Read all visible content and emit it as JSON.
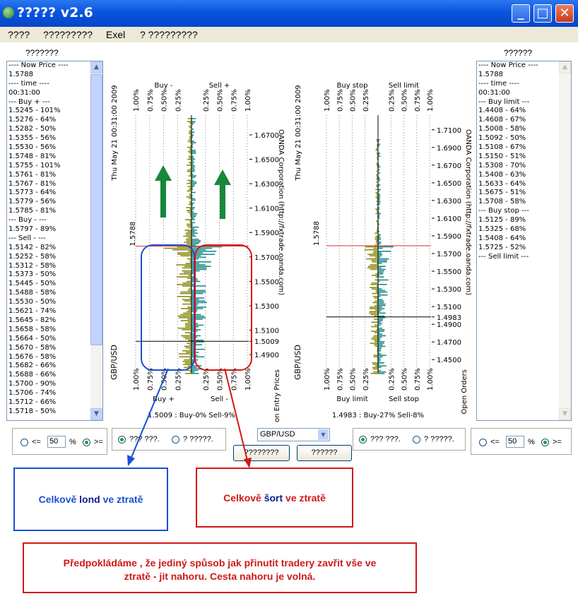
{
  "window": {
    "title": "????? v2.6",
    "minimize": "_",
    "maximize": "□",
    "close": "✕"
  },
  "menu": [
    {
      "label": "????"
    },
    {
      "label": "?????????"
    },
    {
      "label": "Exel"
    },
    {
      "label": "? ?????????"
    }
  ],
  "left_panel": {
    "title": "???????",
    "rows": [
      "---- Now Price ----",
      "1.5788",
      "---- time ----",
      "00:31:00",
      "--- Buy + ---",
      "1.5245 - 101%",
      "1.5276 - 64%",
      "1.5282 - 50%",
      "1.5355 - 56%",
      "1.5530 - 56%",
      "1.5748 - 81%",
      "1.5755 - 101%",
      "1.5761 - 81%",
      "1.5767 - 81%",
      "1.5773 - 64%",
      "1.5779 - 56%",
      "1.5785 - 81%",
      "--- Buy - ---",
      "1.5797 - 89%",
      "--- Sell - ---",
      "1.5142 - 82%",
      "1.5252 - 58%",
      "1.5312 - 58%",
      "1.5373 - 50%",
      "1.5445 - 50%",
      "1.5488 - 58%",
      "1.5530 - 50%",
      "1.5621 - 74%",
      "1.5645 - 82%",
      "1.5658 - 58%",
      "1.5664 - 50%",
      "1.5670 - 58%",
      "1.5676 - 58%",
      "1.5682 - 66%",
      "1.5688 - 66%",
      "1.5700 - 90%",
      "1.5706 - 74%",
      "1.5712 - 66%",
      "1.5718 - 50%"
    ]
  },
  "right_panel": {
    "title": "??????",
    "rows": [
      "---- Now Price ----",
      "1.5788",
      "---- time ----",
      "00:31:00",
      "--- Buy limit ---",
      "1.4408 - 64%",
      "1.4608 - 67%",
      "1.5008 - 58%",
      "1.5092 - 50%",
      "1.5108 - 67%",
      "1.5150 - 51%",
      "1.5308 - 70%",
      "1.5408 - 63%",
      "1.5633 - 64%",
      "1.5675 - 51%",
      "1.5708 - 58%",
      "--- Buy stop ---",
      "1.5125 - 89%",
      "1.5325 - 68%",
      "1.5408 - 64%",
      "1.5725 - 52%",
      "--- Sell limit ---"
    ]
  },
  "chart_data": [
    {
      "type": "bar",
      "title": "Open Position Entry Prices",
      "date_label": "Thu May 21 00:31:00 2009",
      "source": "OANDA Corporation (http://fxtrade.oanda.com)",
      "pair": "GBP/USD",
      "left_series": "Buy -",
      "right_series": "Sell +",
      "bottom_left_series": "Buy +",
      "bottom_right_series": "Sell -",
      "left_ticks": [
        "1.00%",
        "0.75%",
        "0.50%",
        "0.25%"
      ],
      "right_ticks": [
        "0.25%",
        "0.50%",
        "0.75%",
        "1.00%"
      ],
      "price_ticks": [
        "1.6700",
        "1.6500",
        "1.6300",
        "1.6100",
        "1.5900",
        "1.5700",
        "1.5500",
        "1.5300",
        "1.5100",
        "1.5009",
        "1.4900"
      ],
      "current_price": "1.5788",
      "ylim": [
        1.475,
        1.685
      ],
      "marker_price": 1.5009,
      "footer": "1.5009 : Buy-0% Sell-9%",
      "colors": {
        "buy": "#8c8c14",
        "sell": "#1f8b8b",
        "current": "#e03030",
        "marker": "#000000"
      }
    },
    {
      "type": "bar",
      "title": "Open Orders",
      "date_label": "Thu May 21 00:31:00 2009",
      "source": "OANDA Corporation (http://fxtrade.oanda.com)",
      "pair": "GBP/USD",
      "left_series": "Buy stop",
      "right_series": "Sell limit",
      "bottom_left_series": "Buy limit",
      "bottom_right_series": "Sell stop",
      "left_ticks": [
        "1.00%",
        "0.75%",
        "0.50%",
        "0.25%"
      ],
      "right_ticks": [
        "0.25%",
        "0.50%",
        "0.75%",
        "1.00%"
      ],
      "price_ticks": [
        "1.7100",
        "1.6900",
        "1.6700",
        "1.6500",
        "1.6300",
        "1.6100",
        "1.5900",
        "1.5700",
        "1.5500",
        "1.5300",
        "1.5100",
        "1.4983",
        "1.4900",
        "1.4700",
        "1.4500"
      ],
      "current_price": "1.5788",
      "ylim": [
        1.435,
        1.725
      ],
      "marker_price": 1.4983,
      "footer": "1.4983 : Buy-27%  Sell-8%",
      "colors": {
        "buy": "#8c8c14",
        "sell": "#1f8b8b",
        "current": "#e03030",
        "marker": "#000000"
      }
    }
  ],
  "controls": {
    "left": {
      "lte": "<=",
      "value": "50",
      "unit": "%",
      "gte": ">="
    },
    "mid_left": {
      "opt1": "??? ???.",
      "opt2": "? ?????."
    },
    "pair_select": "GBP/USD",
    "button1": "????????",
    "button2": "??????",
    "mid_right": {
      "opt1": "??? ???.",
      "opt2": "? ?????."
    },
    "right": {
      "lte": "<=",
      "value": "50",
      "unit": "%",
      "gte": ">="
    }
  },
  "annotations": {
    "long": {
      "prefix": "Celkově ",
      "highlight": "lond",
      "suffix": " ve ztratě",
      "color": "#1a4fd6"
    },
    "short": {
      "prefix": "Celkově ",
      "highlight": "šort",
      "suffix": " ve ztratě",
      "color": "#d01818"
    },
    "note": "Předpokládáme , že jediný spůsob jak přinutit tradery zavřit vše ve ztratě - jit nahoru. Cesta nahoru je volná."
  }
}
